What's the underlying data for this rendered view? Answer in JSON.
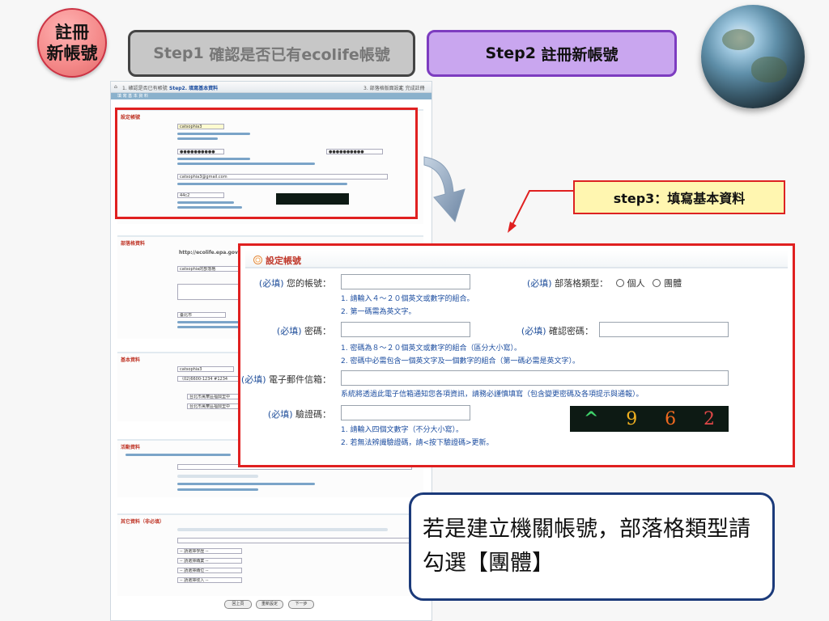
{
  "slide": {
    "title_circle": "註冊\n新帳號",
    "step1_prefix": "Step1",
    "step1_text": "確認是否已有ecolife帳號",
    "step2_prefix": "Step2",
    "step2_text": "註冊新帳號",
    "step3_label": "step3：填寫基本資料",
    "note": "若是建立機關帳號，部落格類型請勾選【團體】"
  },
  "bg_form": {
    "breadcrumb_1": "1. 確認是否已有帳號",
    "breadcrumb_2": "Step2. 填寫基本資料",
    "breadcrumb_3": "3. 部落格版面設定",
    "breadcrumb_4": "4. 完成註冊",
    "header_bar": "填 寫 基 本 資 料",
    "sec1_title": "設定帳號",
    "account_value": "catsophia3",
    "password_value": "●●●●●●●●●●",
    "confirm_value": "●●●●●●●●●●",
    "email_value": "catsophia3@gmail.com",
    "captcha_value": "44c2",
    "sec2_title": "部落格資料",
    "blog_url": "http://ecolife.epa.gov.tw",
    "blog_name": "catsophia的部落格",
    "city_value": "臺北市",
    "sec3_title": "基本資料",
    "name_value": "catsophia3",
    "phone_value": "（02)6600-1234 #1234",
    "addr_value": "台北市萬華區福興里中",
    "sec4_title": "活動資料",
    "sec5_title": "其它資料（非必填）",
    "select_1": "-- 請選擇學歷 --",
    "select_2": "-- 請選擇職業 --",
    "select_3": "-- 請選擇職位 --",
    "select_4": "-- 請選擇收入 --",
    "btn_prev": "回上頁",
    "btn_reset": "重新設定",
    "btn_next": "下一步"
  },
  "panel": {
    "title": "設定帳號",
    "req": "(必填)",
    "account_label": "您的帳號：",
    "blog_type_label": "部落格類型：",
    "blog_type_personal": "個人",
    "blog_type_group": "團體",
    "account_hint_1": "1. 請輸入４～２０個英文或數字的組合。",
    "account_hint_2": "2. 第一碼需為英文字。",
    "password_label": "密碼：",
    "confirm_label": "確認密碼：",
    "password_hint_1": "1. 密碼為８～２０個英文或數字的組合（區分大小寫）。",
    "password_hint_2": "2. 密碼中必需包含一個英文字及一個數字的組合（第一碼必需是英文字）。",
    "email_label": "電子郵件信箱：",
    "email_hint": "系統將透過此電子信箱通知您各項資訊，請務必謹慎填寫（包含變更密碼及各項提示與通報）。",
    "captcha_label": "驗證碼：",
    "captcha_hint_1": "1. 請輸入四個文數字（不分大小寫）。",
    "captcha_hint_2": "2. 若無法辨識驗證碼，請<按下驗證碼>更新。",
    "captcha_chars": [
      "^",
      "9",
      "6",
      "2"
    ]
  },
  "colors": {
    "highlight_red": "#e02020",
    "step2_purple": "#c9a6ef",
    "step3_yellow": "#fff6b0",
    "hint_blue": "#1d4ea0",
    "note_border": "#1b3a7a"
  }
}
